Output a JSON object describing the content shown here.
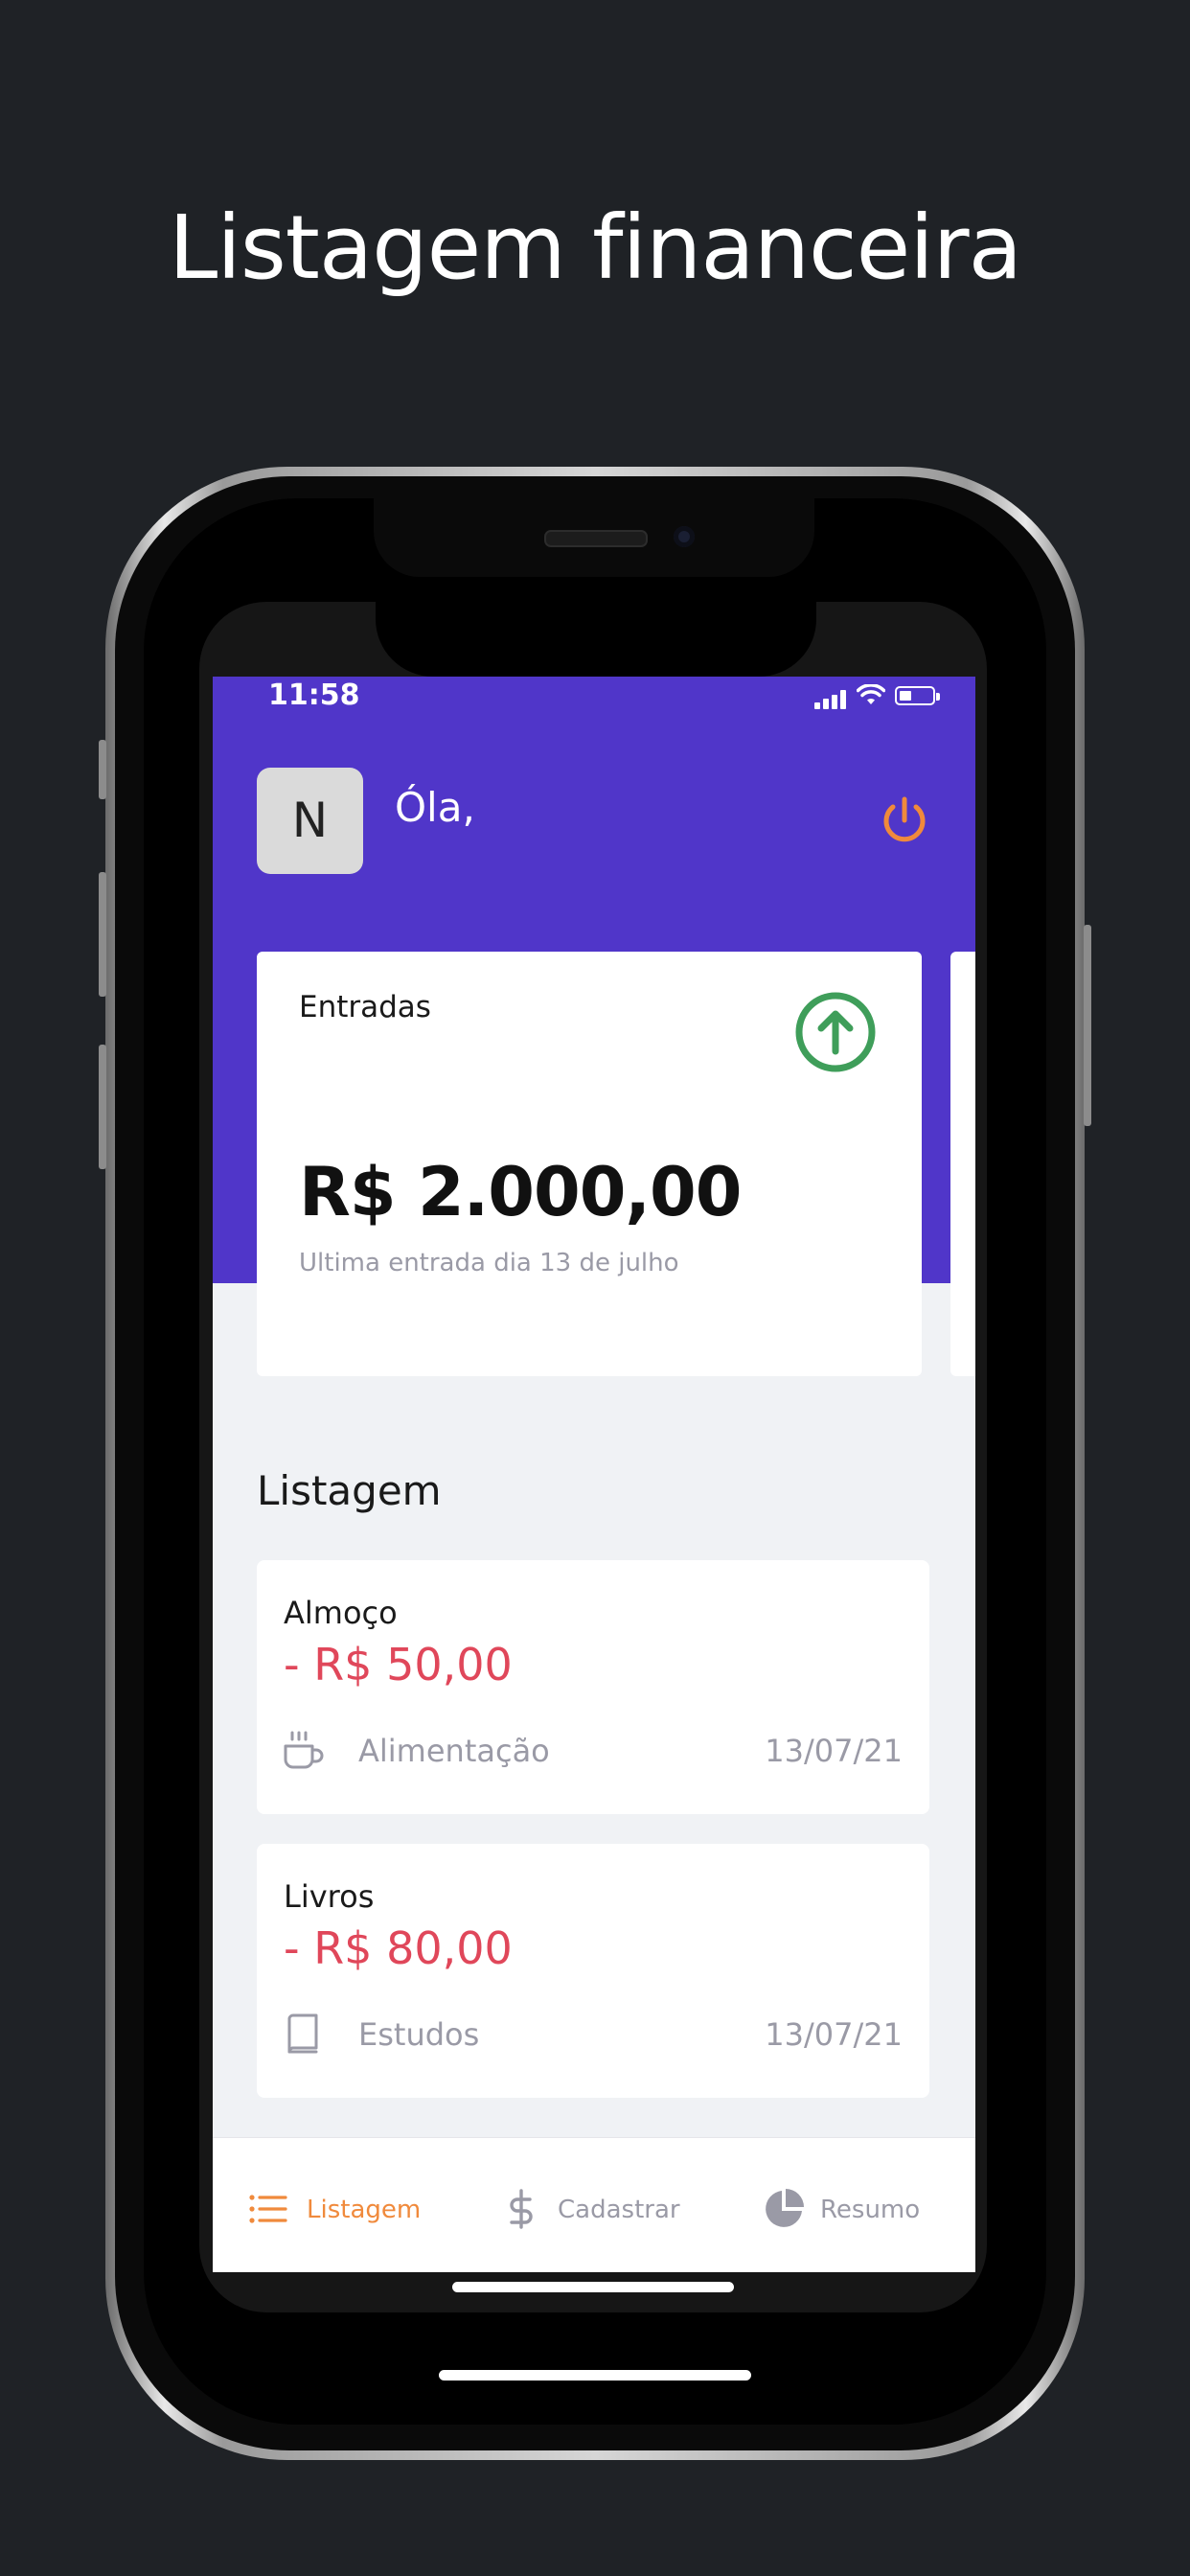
{
  "headline": "Listagem financeira",
  "status_bar": {
    "time": "11:58"
  },
  "header": {
    "avatar_initial": "N",
    "greeting": "Óla,"
  },
  "summary_card": {
    "title": "Entradas",
    "amount": "R$ 2.000,00",
    "subtitle": "Ultima entrada dia 13 de julho",
    "icon": "arrow-up-circle-icon",
    "icon_color": "#3f9e5a"
  },
  "section_title": "Listagem",
  "transactions": [
    {
      "title": "Almoço",
      "amount": "- R$ 50,00",
      "category": "Alimentação",
      "category_icon": "coffee-icon",
      "date": "13/07/21"
    },
    {
      "title": "Livros",
      "amount": "- R$ 80,00",
      "category": "Estudos",
      "category_icon": "book-icon",
      "date": "13/07/21"
    }
  ],
  "tabbar": {
    "items": [
      {
        "label": "Listagem",
        "icon": "list-icon",
        "active": true
      },
      {
        "label": "Cadastrar",
        "icon": "dollar-icon",
        "active": false
      },
      {
        "label": "Resumo",
        "icon": "pie-chart-icon",
        "active": false
      }
    ]
  },
  "colors": {
    "background": "#1f2226",
    "header": "#5036c9",
    "accent": "#f08a3c",
    "expense": "#e0475a",
    "income": "#3f9e5a",
    "muted": "#9a9aa6"
  }
}
